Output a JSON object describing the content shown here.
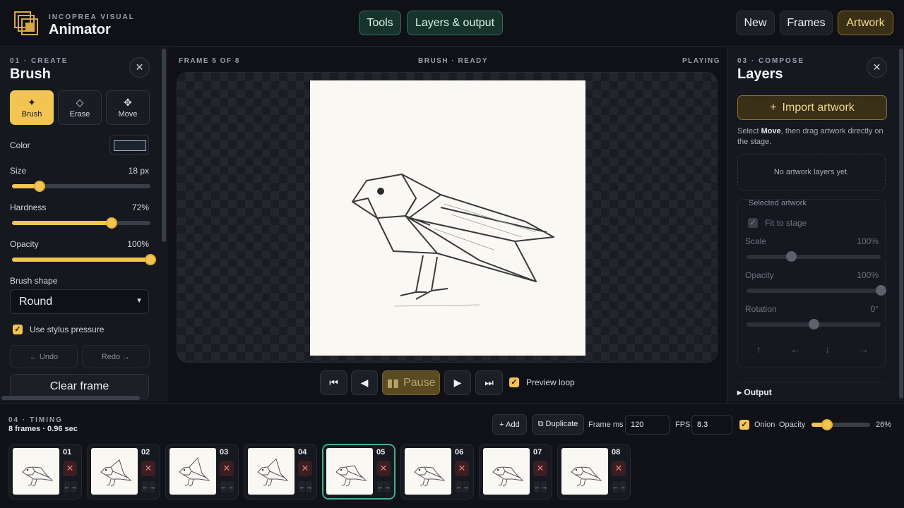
{
  "brand": {
    "subtitle": "INCOPREA VISUAL",
    "title": "Animator"
  },
  "header": {
    "tools_label": "Tools",
    "layers_label": "Layers & output",
    "new_label": "New",
    "frames_label": "Frames",
    "artwork_label": "Artwork"
  },
  "left": {
    "kicker": "01 · CREATE",
    "title": "Brush",
    "tools": [
      {
        "label": "Brush",
        "icon": "sparkle-icon"
      },
      {
        "label": "Erase",
        "icon": "diamond-icon"
      },
      {
        "label": "Move",
        "icon": "move-icon"
      }
    ],
    "color_label": "Color",
    "size_label": "Size",
    "size_value": "18 px",
    "size_level": 0.2,
    "hardness_label": "Hardness",
    "hardness_value": "72%",
    "hardness_level": 0.72,
    "opacity_label": "Opacity",
    "opacity_value": "100%",
    "opacity_level": 1.0,
    "shape_label": "Brush shape",
    "shape_value": "Round",
    "stylus_label": "Use stylus pressure",
    "undo_label": "← Undo",
    "redo_label": "Redo →",
    "clear_label": "Clear frame"
  },
  "center": {
    "frame_status": "FRAME 5 OF 8",
    "tool_status": "BRUSH · READY",
    "play_status": "PLAYING",
    "pause_label": "Pause",
    "preview_loop_label": "Preview loop"
  },
  "right": {
    "kicker": "03 · COMPOSE",
    "title": "Layers",
    "import_label": "Import artwork",
    "hint_prefix": "Select ",
    "hint_bold": "Move",
    "hint_suffix": ", then drag artwork directly on the stage.",
    "empty_label": "No artwork layers yet.",
    "selected_label": "Selected artwork",
    "fit_label": "Fit to stage",
    "scale_label": "Scale",
    "scale_value": "100%",
    "opacity_label": "Opacity",
    "opacity_value": "100%",
    "rotation_label": "Rotation",
    "rotation_value": "0°",
    "output_label": "Output"
  },
  "timeline": {
    "kicker": "04 · TIMING",
    "summary": "8 frames · 0.96 sec",
    "add_label": "+ Add",
    "duplicate_label": "⧉ Duplicate",
    "frame_ms_label": "Frame ms",
    "frame_ms_value": "120",
    "fps_label": "FPS",
    "fps_value": "8.3",
    "onion_label": "Onion",
    "onion_opacity_label": "Opacity",
    "onion_opacity_value": "26%",
    "onion_level": 0.26,
    "frames": [
      "01",
      "02",
      "03",
      "04",
      "05",
      "06",
      "07",
      "08"
    ],
    "active_frame": "05"
  },
  "colors": {
    "accent": "#f2c451",
    "teal": "#3fb38c",
    "danger": "#f07a7a"
  }
}
